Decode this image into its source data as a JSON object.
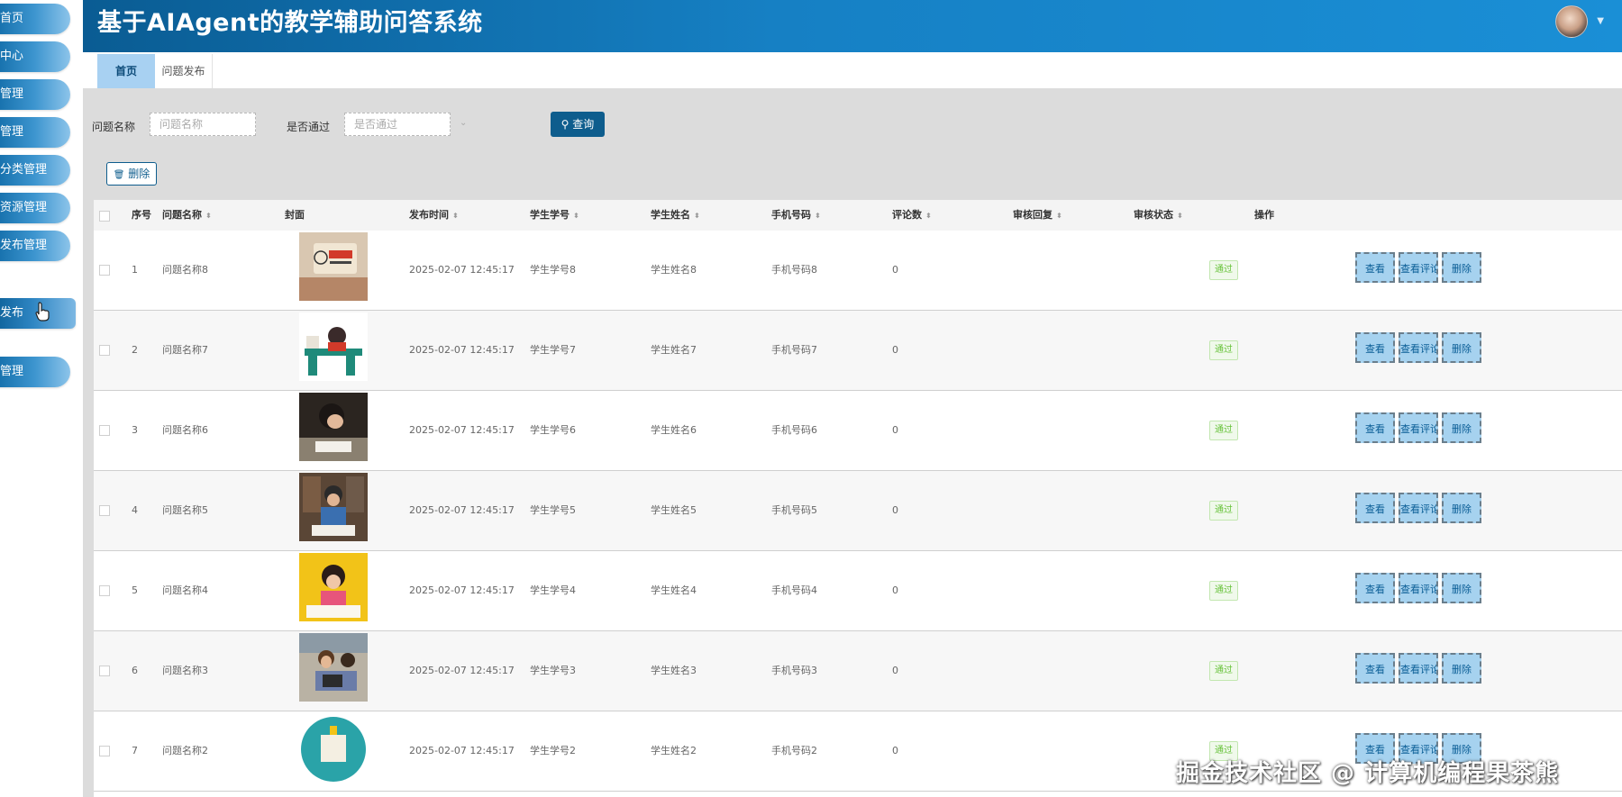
{
  "app": {
    "title": "基于AIAgent的教学辅助问答系统"
  },
  "sidebar": {
    "items": [
      {
        "label": "首页"
      },
      {
        "label": "中心"
      },
      {
        "label": "管理"
      },
      {
        "label": "管理"
      },
      {
        "label": "分类管理"
      },
      {
        "label": "资源管理"
      },
      {
        "label": "发布管理"
      },
      {
        "label": "发布"
      },
      {
        "label": "管理"
      }
    ]
  },
  "tabs": [
    {
      "label": "首页"
    },
    {
      "label": "问题发布"
    }
  ],
  "search": {
    "name_label": "问题名称",
    "name_placeholder": "问题名称",
    "pass_label": "是否通过",
    "pass_placeholder": "是否通过",
    "query_label": "查询"
  },
  "toolbar": {
    "delete_label": "删除"
  },
  "table": {
    "headers": {
      "index": "序号",
      "name": "问题名称",
      "cover": "封面",
      "time": "发布时间",
      "student_id": "学生学号",
      "student_name": "学生姓名",
      "phone": "手机号码",
      "comments": "评论数",
      "reply": "审核回复",
      "status": "审核状态",
      "actions": "操作"
    },
    "rows": [
      {
        "index": "1",
        "name": "问题名称8",
        "time": "2025-02-07 12:45:17",
        "student_id": "学生学号8",
        "student_name": "学生姓名8",
        "phone": "手机号码8",
        "comments": "0",
        "status": "通过"
      },
      {
        "index": "2",
        "name": "问题名称7",
        "time": "2025-02-07 12:45:17",
        "student_id": "学生学号7",
        "student_name": "学生姓名7",
        "phone": "手机号码7",
        "comments": "0",
        "status": "通过"
      },
      {
        "index": "3",
        "name": "问题名称6",
        "time": "2025-02-07 12:45:17",
        "student_id": "学生学号6",
        "student_name": "学生姓名6",
        "phone": "手机号码6",
        "comments": "0",
        "status": "通过"
      },
      {
        "index": "4",
        "name": "问题名称5",
        "time": "2025-02-07 12:45:17",
        "student_id": "学生学号5",
        "student_name": "学生姓名5",
        "phone": "手机号码5",
        "comments": "0",
        "status": "通过"
      },
      {
        "index": "5",
        "name": "问题名称4",
        "time": "2025-02-07 12:45:17",
        "student_id": "学生学号4",
        "student_name": "学生姓名4",
        "phone": "手机号码4",
        "comments": "0",
        "status": "通过"
      },
      {
        "index": "6",
        "name": "问题名称3",
        "time": "2025-02-07 12:45:17",
        "student_id": "学生学号3",
        "student_name": "学生姓名3",
        "phone": "手机号码3",
        "comments": "0",
        "status": "通过"
      },
      {
        "index": "7",
        "name": "问题名称2",
        "time": "2025-02-07 12:45:17",
        "student_id": "学生学号2",
        "student_name": "学生姓名2",
        "phone": "手机号码2",
        "comments": "0",
        "status": "通过"
      }
    ],
    "actions": {
      "view": "查看",
      "view_comments": "查看评论",
      "delete": "删除"
    }
  },
  "watermark": "掘金技术社区 @ 计算机编程果茶熊"
}
